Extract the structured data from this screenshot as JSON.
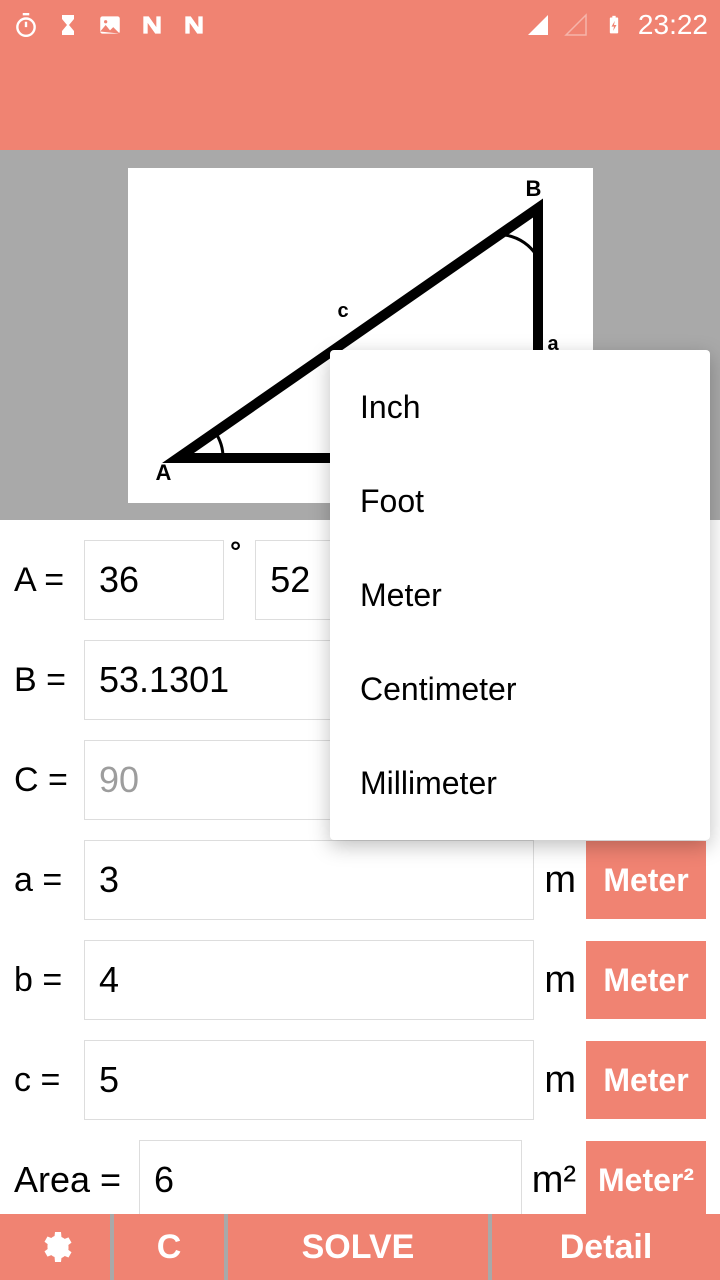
{
  "status": {
    "time": "23:22"
  },
  "angles": {
    "A_label": "A =",
    "A_deg": "36",
    "A_min": "52",
    "B_label": "B =",
    "B_val": "53.1301",
    "C_label": "C =",
    "C_val": "90"
  },
  "sides": {
    "a_label": "a =",
    "a_val": "3",
    "a_unit": "m",
    "a_btn": "Meter",
    "b_label": "b =",
    "b_val": "4",
    "b_unit": "m",
    "b_btn": "Meter",
    "c_label": "c =",
    "c_val": "5",
    "c_unit": "m",
    "c_btn": "Meter"
  },
  "area": {
    "label": "Area =",
    "val": "6",
    "unit": "m²",
    "btn": "Meter²"
  },
  "diagram": {
    "A": "A",
    "B": "B",
    "a": "a",
    "c": "c"
  },
  "dropdown": {
    "opt0": "Inch",
    "opt1": "Foot",
    "opt2": "Meter",
    "opt3": "Centimeter",
    "opt4": "Millimeter"
  },
  "bottom": {
    "clear": "C",
    "solve": "SOLVE",
    "detail": "Detail"
  }
}
